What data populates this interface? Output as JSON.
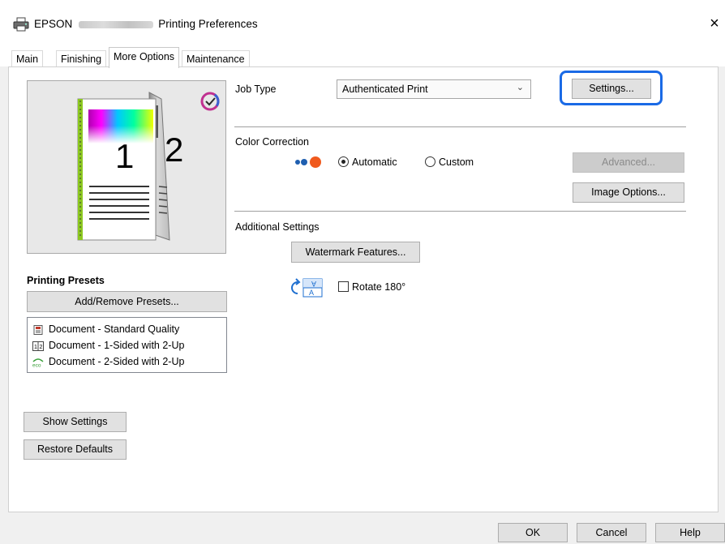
{
  "window": {
    "title_prefix": "EPSON",
    "title_suffix": "Printing Preferences",
    "close_glyph": "×"
  },
  "tabs": [
    {
      "label": "Main",
      "active": false
    },
    {
      "label": "Finishing",
      "active": false
    },
    {
      "label": "More Options",
      "active": true
    },
    {
      "label": "Maintenance",
      "active": false
    }
  ],
  "preview": {
    "page_front_number": "1",
    "page_back_number": "2",
    "color_check_icon": "color-check-icon"
  },
  "job_type": {
    "label": "Job Type",
    "selected": "Authenticated Print",
    "settings_button": "Settings..."
  },
  "color_correction": {
    "label": "Color Correction",
    "automatic_label": "Automatic",
    "automatic_checked": true,
    "custom_label": "Custom",
    "custom_checked": false,
    "advanced_button": "Advanced...",
    "image_options_button": "Image Options..."
  },
  "additional_settings": {
    "label": "Additional Settings",
    "watermark_button": "Watermark Features...",
    "rotate_label": "Rotate 180°",
    "rotate_checked": false
  },
  "presets": {
    "heading": "Printing Presets",
    "add_remove_button": "Add/Remove Presets...",
    "items": [
      {
        "label": "Document - Standard Quality",
        "icon": "document-icon"
      },
      {
        "label": "Document - 1-Sided with 2-Up",
        "icon": "two-up-icon"
      },
      {
        "label": "Document - 2-Sided with 2-Up",
        "icon": "eco-icon"
      }
    ]
  },
  "left_buttons": {
    "show_settings": "Show Settings",
    "restore_defaults": "Restore Defaults"
  },
  "footer": {
    "ok": "OK",
    "cancel": "Cancel",
    "help": "Help"
  },
  "colors": {
    "highlight": "#1a6ae6",
    "preview_border": "#a9a9a9"
  }
}
